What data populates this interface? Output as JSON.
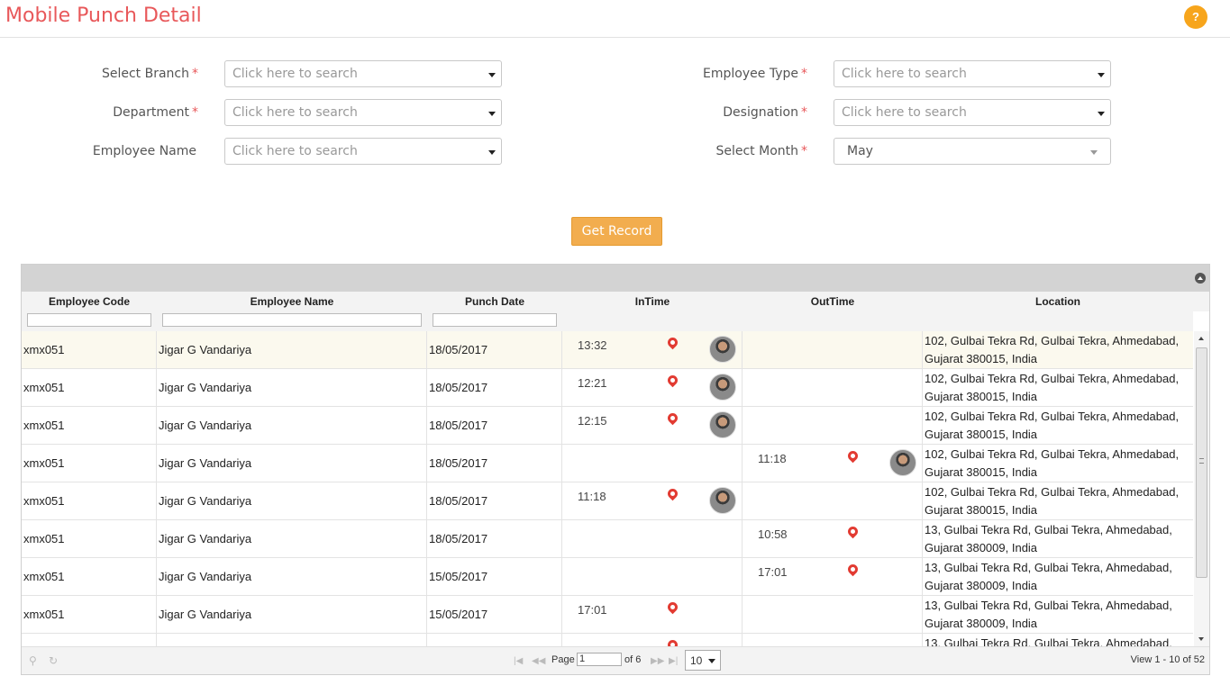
{
  "header": {
    "title": "Mobile Punch Detail",
    "help_label": "?"
  },
  "form": {
    "branch": {
      "label": "Select Branch",
      "required": "*",
      "value": "Click here to search"
    },
    "department": {
      "label": "Department",
      "required": "*",
      "value": "Click here to search"
    },
    "employee_name": {
      "label": "Employee Name",
      "value": "Click here to search"
    },
    "employee_type": {
      "label": "Employee Type",
      "required": "*",
      "value": "Click here to search"
    },
    "designation": {
      "label": "Designation",
      "required": "*",
      "value": "Click here to search"
    },
    "month": {
      "label": "Select Month",
      "required": "*",
      "value": "May"
    },
    "get_record_label": "Get Record"
  },
  "grid": {
    "columns": [
      "Employee Code",
      "Employee Name",
      "Punch Date",
      "InTime",
      "OutTime",
      "Location"
    ],
    "rows": [
      {
        "code": "xmx051",
        "name": "Jigar G Vandariya",
        "date": "18/05/2017",
        "in": "13:32",
        "in_pin": true,
        "in_photo": true,
        "out": "",
        "out_pin": false,
        "out_photo": false,
        "location": "102, Gulbai Tekra Rd, Gulbai Tekra, Ahmedabad, Gujarat 380015, India"
      },
      {
        "code": "xmx051",
        "name": "Jigar G Vandariya",
        "date": "18/05/2017",
        "in": "12:21",
        "in_pin": true,
        "in_photo": true,
        "out": "",
        "out_pin": false,
        "out_photo": false,
        "location": "102, Gulbai Tekra Rd, Gulbai Tekra, Ahmedabad, Gujarat 380015, India"
      },
      {
        "code": "xmx051",
        "name": "Jigar G Vandariya",
        "date": "18/05/2017",
        "in": "12:15",
        "in_pin": true,
        "in_photo": true,
        "out": "",
        "out_pin": false,
        "out_photo": false,
        "location": "102, Gulbai Tekra Rd, Gulbai Tekra, Ahmedabad, Gujarat 380015, India"
      },
      {
        "code": "xmx051",
        "name": "Jigar G Vandariya",
        "date": "18/05/2017",
        "in": "",
        "in_pin": false,
        "in_photo": false,
        "out": "11:18",
        "out_pin": true,
        "out_photo": true,
        "location": "102, Gulbai Tekra Rd, Gulbai Tekra, Ahmedabad, Gujarat 380015, India"
      },
      {
        "code": "xmx051",
        "name": "Jigar G Vandariya",
        "date": "18/05/2017",
        "in": "11:18",
        "in_pin": true,
        "in_photo": true,
        "out": "",
        "out_pin": false,
        "out_photo": false,
        "location": "102, Gulbai Tekra Rd, Gulbai Tekra, Ahmedabad, Gujarat 380015, India"
      },
      {
        "code": "xmx051",
        "name": "Jigar G Vandariya",
        "date": "18/05/2017",
        "in": "",
        "in_pin": false,
        "in_photo": false,
        "out": "10:58",
        "out_pin": true,
        "out_photo": false,
        "location": "13, Gulbai Tekra Rd, Gulbai Tekra, Ahmedabad, Gujarat 380009, India"
      },
      {
        "code": "xmx051",
        "name": "Jigar G Vandariya",
        "date": "15/05/2017",
        "in": "",
        "in_pin": false,
        "in_photo": false,
        "out": "17:01",
        "out_pin": true,
        "out_photo": false,
        "location": "13, Gulbai Tekra Rd, Gulbai Tekra, Ahmedabad, Gujarat 380009, India"
      },
      {
        "code": "xmx051",
        "name": "Jigar G Vandariya",
        "date": "15/05/2017",
        "in": "17:01",
        "in_pin": true,
        "in_photo": false,
        "out": "",
        "out_pin": false,
        "out_photo": false,
        "location": "13, Gulbai Tekra Rd, Gulbai Tekra, Ahmedabad, Gujarat 380009, India"
      },
      {
        "code": "",
        "name": "",
        "date": "",
        "in": "",
        "in_pin": true,
        "in_photo": false,
        "out": "",
        "out_pin": false,
        "out_photo": false,
        "location": "13, Gulbai Tekra Rd, Gulbai Tekra, Ahmedabad,"
      }
    ],
    "pager": {
      "page_label": "Page",
      "page_value": "1",
      "of_label": "of 6",
      "rows_per_page": "10",
      "view_label": "View 1 - 10 of 52"
    }
  }
}
